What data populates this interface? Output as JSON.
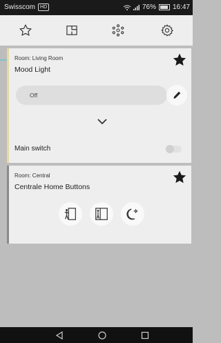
{
  "status_bar": {
    "carrier": "Swisscom",
    "carrier_badge": "HD",
    "battery": "76%",
    "time": "16:47"
  },
  "toolbar": {
    "tabs": [
      {
        "icon": "star-outline-icon"
      },
      {
        "icon": "floorplan-icon"
      },
      {
        "icon": "devices-icon"
      },
      {
        "icon": "settings-gear-icon"
      }
    ],
    "active_tab": 0
  },
  "cards": [
    {
      "room": "Room: Living Room",
      "title": "Mood Light",
      "favorite": true,
      "scene_value": "Off",
      "switch_label": "Main switch",
      "switch_on": false
    },
    {
      "room": "Room: Central",
      "title": "Centrale Home Buttons",
      "favorite": true,
      "buttons": [
        {
          "icon": "leave-home-icon"
        },
        {
          "icon": "come-home-icon"
        },
        {
          "icon": "night-moon-icon"
        }
      ]
    }
  ],
  "colors": {
    "accent": "#7fc1c7",
    "card_bg": "#eeeeee",
    "card1_border": "#e6d9a2",
    "background": "#bdbdbd"
  }
}
